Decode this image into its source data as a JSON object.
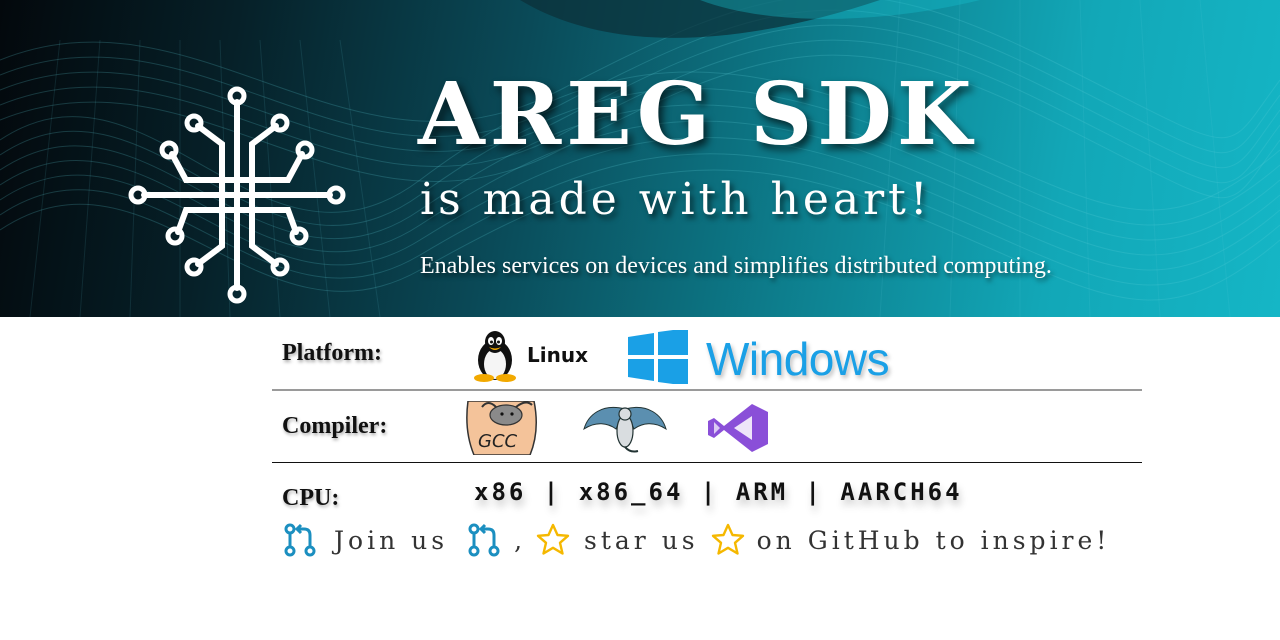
{
  "banner": {
    "title": "AREG SDK",
    "subtitle": "is made with heart!",
    "tagline": "Enables services on devices and simplifies distributed computing."
  },
  "platform": {
    "label": "Platform:",
    "linux_label": "Linux",
    "windows_label": "Windows"
  },
  "compiler": {
    "label": "Compiler:",
    "gcc_label": "GCC"
  },
  "cpu": {
    "label": "CPU:",
    "list": "x86 | x86_64 | ARM | AARCH64"
  },
  "cta": {
    "join": "Join us",
    "comma": ",",
    "star": "star us",
    "tail": "on GitHub to inspire!"
  },
  "colors": {
    "banner_dark": "#03080c",
    "banner_teal": "#15b6c6",
    "windows_blue": "#1aa0e6",
    "pr_icon": "#1b8fc0",
    "star_icon": "#f5b800",
    "vs_purple": "#8a4fd8"
  },
  "icons": {
    "logo": "circuit-logo-icon",
    "linux": "tux-icon",
    "windows": "windows-logo-icon",
    "gcc": "gcc-gnu-icon",
    "clang": "llvm-dragon-icon",
    "msvc": "visual-studio-icon",
    "pull_request": "pull-request-icon",
    "star": "star-icon"
  }
}
